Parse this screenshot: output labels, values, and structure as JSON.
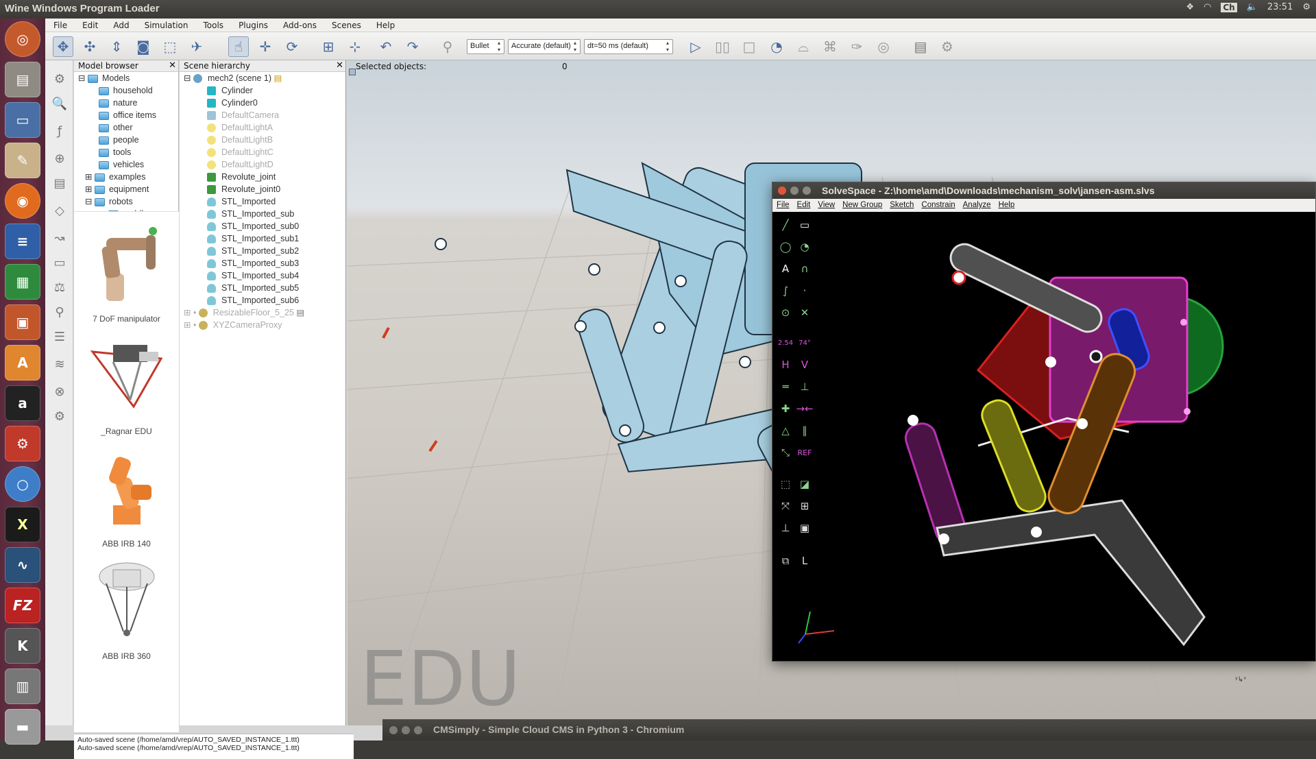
{
  "topbar": {
    "title": "Wine Windows Program Loader",
    "kb": "Ch",
    "time": "23:51",
    "icons": [
      "dropbox-icon",
      "wifi-icon",
      "keyboard-layout-icon",
      "volume-icon",
      "power-icon"
    ]
  },
  "menu": {
    "items": [
      "File",
      "Edit",
      "Add",
      "Simulation",
      "Tools",
      "Plugins",
      "Add-ons",
      "Scenes",
      "Help"
    ]
  },
  "toolbar": {
    "engine": "Bullet",
    "accuracy": "Accurate (default)",
    "timestep": "dt=50 ms (default)"
  },
  "model_browser": {
    "title": "Model browser",
    "root": "Models",
    "folders": [
      "household",
      "nature",
      "office items",
      "other",
      "people",
      "tools",
      "vehicles",
      "examples",
      "equipment",
      "robots",
      "mobile"
    ],
    "thumbnails": [
      "7 DoF manipulator",
      "_Ragnar EDU",
      "ABB IRB 140",
      "ABB IRB 360"
    ]
  },
  "scene_hierarchy": {
    "title": "Scene hierarchy",
    "scene": "mech2 (scene 1)",
    "objects": [
      "Cylinder",
      "Cylinder0",
      "DefaultCamera",
      "DefaultLightA",
      "DefaultLightB",
      "DefaultLightC",
      "DefaultLightD",
      "Revolute_joint",
      "Revolute_joint0",
      "STL_Imported",
      "STL_Imported_sub",
      "STL_Imported_sub0",
      "STL_Imported_sub1",
      "STL_Imported_sub2",
      "STL_Imported_sub3",
      "STL_Imported_sub4",
      "STL_Imported_sub5",
      "STL_Imported_sub6",
      "ResizableFloor_5_25",
      "XYZCameraProxy"
    ]
  },
  "viewport": {
    "selected_label": "Selected objects:",
    "selected_count": "0",
    "watermark": "EDU"
  },
  "status": {
    "lines": [
      "Auto-saved scene (/home/amd/vrep/AUTO_SAVED_INSTANCE_1.ttt)",
      "Auto-saved scene (/home/amd/vrep/AUTO_SAVED_INSTANCE_1.ttt)"
    ]
  },
  "solvespace": {
    "title": "SolveSpace - Z:\\home\\amd\\Downloads\\mechanism_solv\\jansen-asm.slvs",
    "menu": [
      "File",
      "Edit",
      "View",
      "New Group",
      "Sketch",
      "Constrain",
      "Analyze",
      "Help"
    ],
    "tool_labels": {
      "dim": "2.54",
      "angle": "74°",
      "h": "H",
      "v": "V",
      "ref": "REF"
    }
  },
  "chromium": {
    "title": "CMSimply - Simple Cloud CMS in Python 3 - Chromium"
  }
}
